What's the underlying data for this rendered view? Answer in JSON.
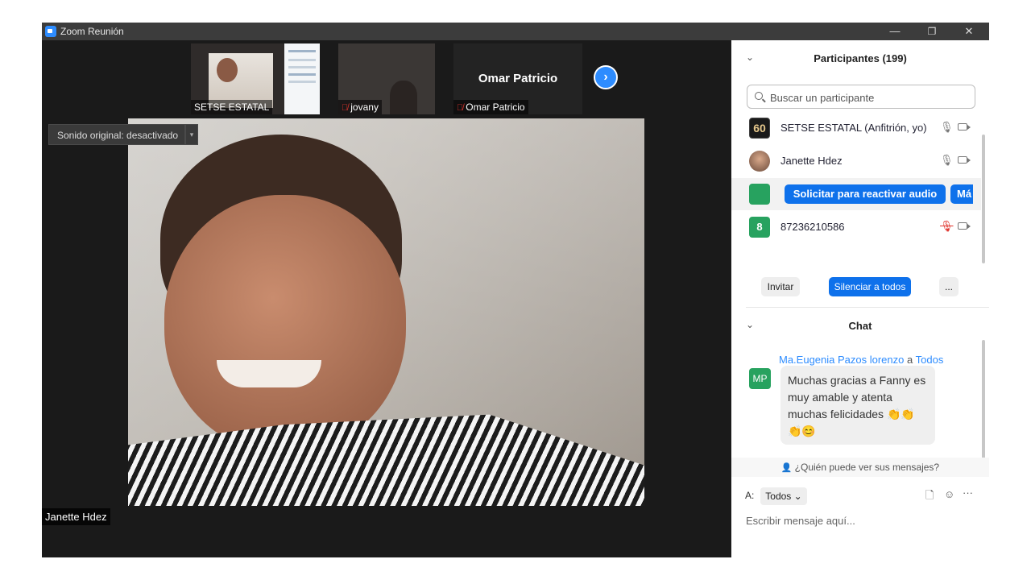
{
  "window": {
    "title": "Zoom Reunión",
    "controls": {
      "minimize": "—",
      "restore": "❐",
      "close": "✕"
    }
  },
  "thumbnails": [
    {
      "name": "SETSE ESTATAL",
      "muted": false
    },
    {
      "name": "jovany",
      "muted": true
    },
    {
      "name": "Omar Patricio",
      "muted": true,
      "display_name": "Omar Patricio"
    }
  ],
  "next_arrow": "›",
  "sound_chip": {
    "label": "Sonido original: desactivado",
    "dropdown": "▾"
  },
  "active_speaker": "Janette Hdez",
  "participants": {
    "title": "Participantes (199)",
    "search_placeholder": "Buscar un participante",
    "list": [
      {
        "avatar_text": "60",
        "avatar_color": "#1a1a1a",
        "name": "SETSE ESTATAL (Anfitrión, yo)",
        "mic": "🎙"
      },
      {
        "avatar_text": "",
        "avatar_color": "#c89a7d",
        "name": "Janette Hdez",
        "mic": "🎙"
      },
      {
        "avatar_text": "",
        "avatar_color": "#27a25f",
        "name": "",
        "action_button": "Solicitar para reactivar audio",
        "more_button": "Má"
      },
      {
        "avatar_text": "8",
        "avatar_color": "#27a25f",
        "name": "87236210586",
        "mic": "🎙"
      }
    ],
    "buttons": {
      "invite": "Invitar",
      "mute_all": "Silenciar a todos",
      "more": "..."
    }
  },
  "chat": {
    "title": "Chat",
    "messages": [
      {
        "sender": "Ma.Eugenia Pazos lorenzo",
        "to_prefix": "a",
        "recipient": "Todos",
        "avatar": "MP",
        "avatar_color": "#27a25f",
        "text": "Muchas gracias a Fanny es muy amable y atenta muchas felicidades 👏👏👏😊"
      }
    ],
    "who_can_see": "¿Quién puede ver sus mensajes?",
    "to_label": "A:",
    "recipient_select": "Todos ⌄",
    "placeholder": "Escribir mensaje aquí...",
    "more_tools": "···"
  },
  "colors": {
    "accent": "#0e71eb",
    "stage": "#1a1a1a",
    "mute_red": "#e0342d"
  }
}
